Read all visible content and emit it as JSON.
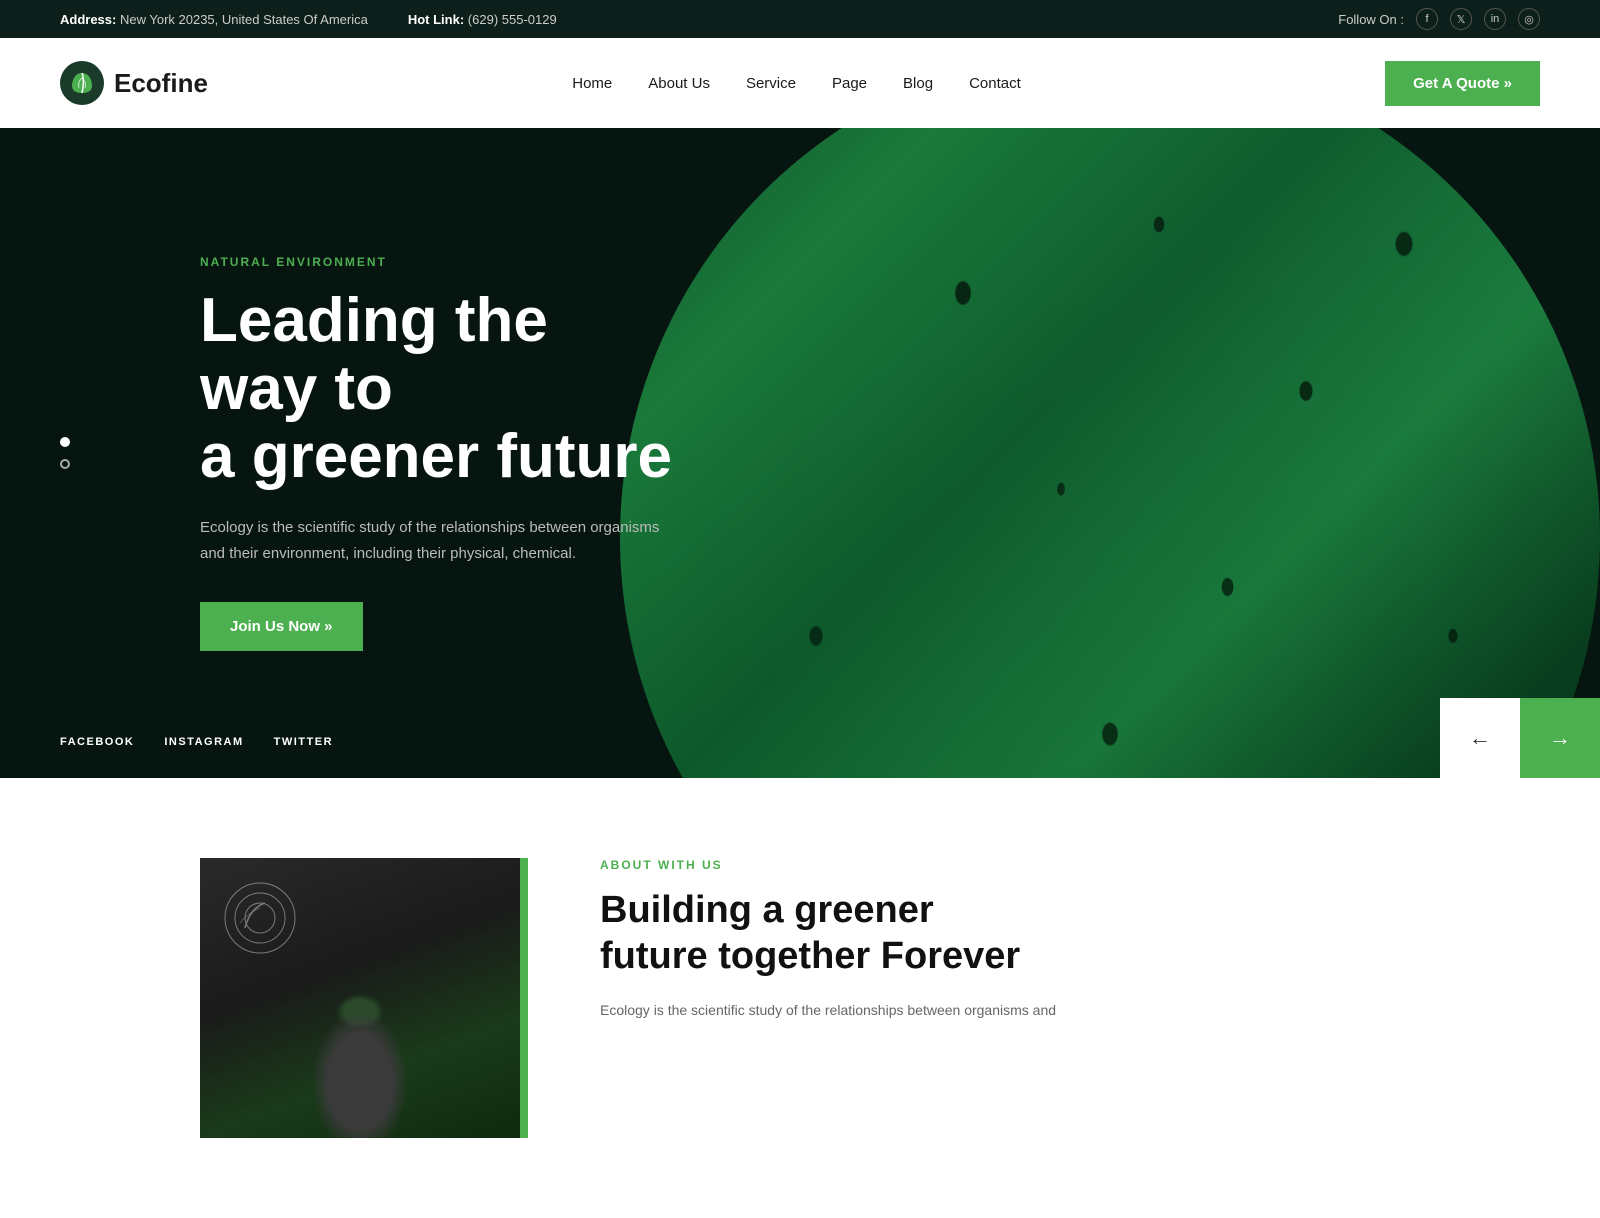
{
  "topbar": {
    "address_label": "Address:",
    "address_value": "New York 20235, United States Of America",
    "hotlink_label": "Hot Link:",
    "hotlink_value": "(629) 555-0129",
    "follow_label": "Follow On :",
    "social_icons": [
      {
        "name": "facebook",
        "symbol": "f"
      },
      {
        "name": "twitter",
        "symbol": "t"
      },
      {
        "name": "linkedin",
        "symbol": "in"
      },
      {
        "name": "instagram",
        "symbol": "ig"
      }
    ]
  },
  "header": {
    "logo_text": "Ecofine",
    "nav": [
      {
        "label": "Home",
        "active": true
      },
      {
        "label": "About Us"
      },
      {
        "label": "Service"
      },
      {
        "label": "Page"
      },
      {
        "label": "Blog"
      },
      {
        "label": "Contact"
      }
    ],
    "cta_label": "Get A Quote »"
  },
  "hero": {
    "subtitle": "NATURAL ENVIRONMENT",
    "title_line1": "Leading the way to",
    "title_line2": "a greener future",
    "description": "Ecology is the scientific study of the relationships between organisms and their environment, including their physical, chemical.",
    "btn_label": "Join Us Now »",
    "socials": [
      {
        "label": "FACEBOOK"
      },
      {
        "label": "INSTAGRAM"
      },
      {
        "label": "TWITTER"
      }
    ],
    "slide_active": 0,
    "slide_count": 2
  },
  "about": {
    "label": "ABOUT WITH US",
    "title_line1": "Building a greener",
    "title_line2": "future together Forever",
    "description": "Ecology is the scientific study of the relationships between organisms and"
  },
  "arrows": {
    "prev": "←",
    "next": "→"
  }
}
